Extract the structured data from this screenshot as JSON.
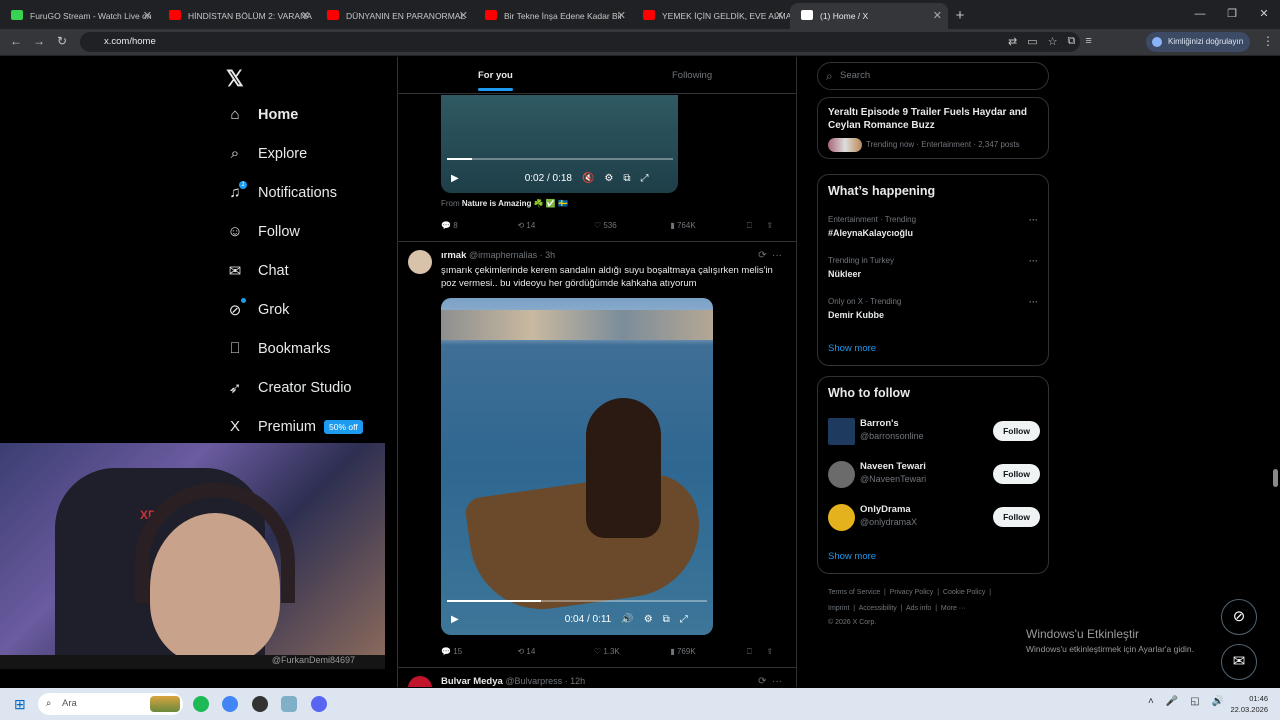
{
  "browser": {
    "tabs": [
      {
        "title": "FuruGO Stream - Watch Live on",
        "color": "#39d353"
      },
      {
        "title": "HİNDİSTAN BÖLÜM 2: VARANA",
        "color": "#ff0000"
      },
      {
        "title": "DÜNYANIN EN PARANORMAL",
        "color": "#ff0000"
      },
      {
        "title": "Bir Tekne İnşa Edene Kadar Bir",
        "color": "#ff0000"
      },
      {
        "title": "YEMEK İÇİN GELDİK, EVE ALMA",
        "color": "#ff0000"
      },
      {
        "title": "(1) Home / X",
        "color": "#ffffff"
      }
    ],
    "url": "x.com/home",
    "profile_label": "Kimliğinizi doğrulayın"
  },
  "sidebar": {
    "items": [
      {
        "label": "Home",
        "icon": "home-icon",
        "glyph": "⌂"
      },
      {
        "label": "Explore",
        "icon": "search-icon",
        "glyph": "⌕"
      },
      {
        "label": "Notifications",
        "icon": "bell-icon",
        "glyph": "♫"
      },
      {
        "label": "Follow",
        "icon": "follow-icon",
        "glyph": "☺"
      },
      {
        "label": "Chat",
        "icon": "mail-icon",
        "glyph": "✉"
      },
      {
        "label": "Grok",
        "icon": "grok-icon",
        "glyph": "⊘"
      },
      {
        "label": "Bookmarks",
        "icon": "bookmark-icon",
        "glyph": "⎕"
      },
      {
        "label": "Creator Studio",
        "icon": "rocket-icon",
        "glyph": "➶"
      },
      {
        "label": "Premium",
        "icon": "x-icon",
        "glyph": "X"
      }
    ],
    "notifications_badge": "1",
    "premium_badge": "50% off"
  },
  "webcam": {
    "handle": "@FurkanDemi84697"
  },
  "feed": {
    "tabs": [
      "For you",
      "Following"
    ],
    "tweet1": {
      "video_time": "0:02 / 0:18",
      "from_label": "From",
      "from_name": "Nature is Amazing ☘️ ✅ 🇸🇪",
      "replies": "8",
      "retweets": "14",
      "likes": "536",
      "views": "764K",
      "progress": 0.11
    },
    "tweet2": {
      "name": "ırmak",
      "handle": "@irmaphernalias · 3h",
      "text": "şımarık çekimlerinde kerem sandalın aldığı suyu boşaltmaya çalışırken melis'in poz vermesi.. bu videoyu her gördüğümde kahkaha atıyorum",
      "video_time": "0:04 / 0:11",
      "replies": "15",
      "retweets": "14",
      "likes": "1.3K",
      "views": "769K",
      "progress": 0.36
    },
    "tweet3": {
      "name": "Bulvar Medya",
      "handle": "@Bulvarpress · 12h"
    }
  },
  "right": {
    "search_placeholder": "Search",
    "top_card": {
      "title": "Yeraltı Episode 9 Trailer Fuels Haydar and Ceylan Romance Buzz",
      "meta": "Trending now · Entertainment · 2,347 posts"
    },
    "happening": {
      "title": "What’s happening",
      "trends": [
        {
          "context": "Entertainment · Trending",
          "name": "#AleynaKalaycıoğlu"
        },
        {
          "context": "Trending in Turkey",
          "name": "Nükleer"
        },
        {
          "context": "Only on X · Trending",
          "name": "Demir Kubbe"
        }
      ],
      "show_more": "Show more"
    },
    "who_to_follow": {
      "title": "Who to follow",
      "users": [
        {
          "name": "Barron's",
          "handle": "@barronsonline",
          "button": "Follow",
          "avatar_color": "#1f3a5f"
        },
        {
          "name": "Naveen Tewari",
          "handle": "@NaveenTewari",
          "button": "Follow",
          "avatar_color": "#6b6b6b"
        },
        {
          "name": "OnlyDrama",
          "handle": "@onlydramaX",
          "button": "Follow",
          "avatar_color": "#e3b21c"
        }
      ],
      "show_more": "Show more"
    },
    "footer": {
      "line1": [
        "Terms of Service",
        "|",
        "Privacy Policy",
        "|",
        "Cookie Policy",
        "|"
      ],
      "line2": [
        "Imprint",
        "|",
        "Accessibility",
        "|",
        "Ads info",
        "|",
        "More ···"
      ],
      "copyright": "© 2026 X Corp."
    }
  },
  "windows": {
    "activate_title": "Windows'u Etkinleştir",
    "activate_sub": "Windows'u etkinleştirmek için Ayarlar'a gidin.",
    "search": "Ara",
    "time": "01:46",
    "date": "22.03.2026"
  }
}
